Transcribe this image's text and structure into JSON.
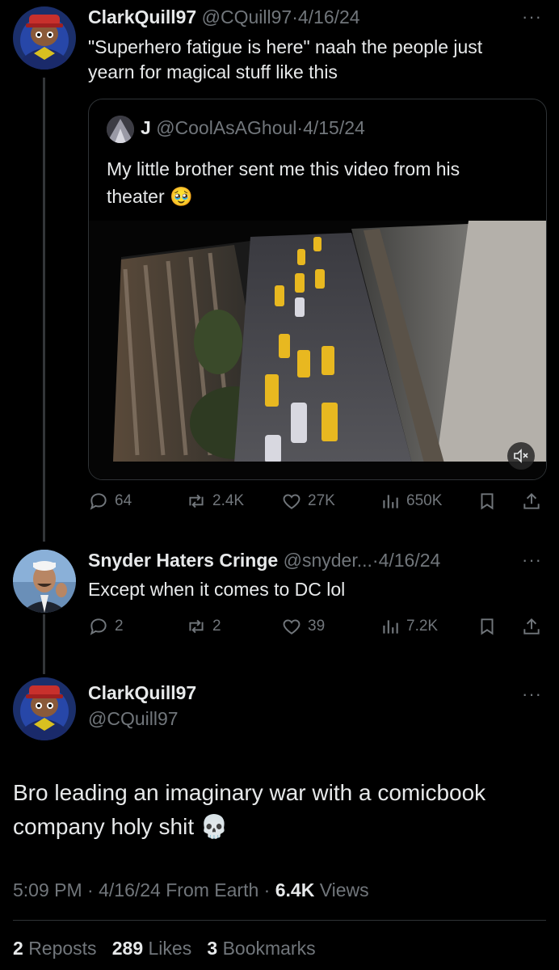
{
  "tweet1": {
    "name": "ClarkQuill97",
    "handle": "@CQuill97",
    "date": "4/16/24",
    "text_line1": "\"Superhero fatigue is here\" naah the people just",
    "text_line2": "yearn for magical stuff like this",
    "quote": {
      "name": "J",
      "handle": "@CoolAsAGhoul",
      "date": "4/15/24",
      "text_line1": "My little brother sent me this video from his",
      "text_line2": "theater",
      "emoji": "🥹"
    },
    "stats": {
      "replies": "64",
      "reposts": "2.4K",
      "likes": "27K",
      "views": "650K"
    }
  },
  "tweet2": {
    "name": "Snyder Haters Cringe",
    "handle": "@snyder...",
    "date": "4/16/24",
    "text": "Except when it comes to DC lol",
    "stats": {
      "replies": "2",
      "reposts": "2",
      "likes": "39",
      "views": "7.2K"
    }
  },
  "main": {
    "name": "ClarkQuill97",
    "handle": "@CQuill97",
    "text_line1": "Bro leading an imaginary war with a comicbook",
    "text_line2": "company holy shit",
    "emoji": "💀",
    "time": "5:09 PM",
    "date": "4/16/24",
    "from": "From Earth",
    "views_count": "6.4K",
    "views_label": "Views",
    "reposts_count": "2",
    "reposts_label": "Reposts",
    "likes_count": "289",
    "likes_label": "Likes",
    "bookmarks_count": "3",
    "bookmarks_label": "Bookmarks"
  },
  "separator": "·",
  "more_label": "···",
  "colors": {
    "background": "#000000",
    "text": "#e7e9ea",
    "muted": "#71767b",
    "border": "#2f3336"
  },
  "icons": [
    "reply-icon",
    "repost-icon",
    "like-icon",
    "views-icon",
    "bookmark-icon",
    "share-icon",
    "mute-icon"
  ]
}
